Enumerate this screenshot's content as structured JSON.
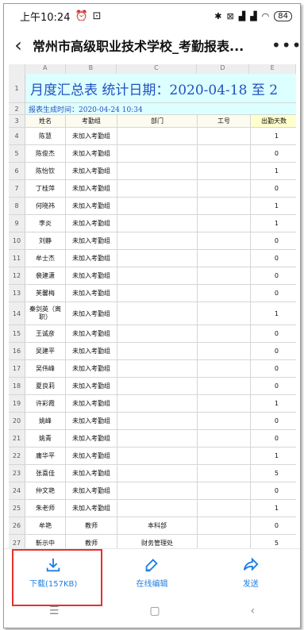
{
  "status": {
    "time": "上午10:24",
    "battery": "84"
  },
  "appbar": {
    "title": "常州市高级职业技术学校_考勤报表..."
  },
  "sheet": {
    "col_letters": [
      "A",
      "B",
      "C",
      "D",
      "E"
    ],
    "title_text": "月度汇总表  统计日期：2020-04-18 至 2",
    "generated": "报表生成时间：2020-04-24 10:34",
    "headers": [
      "姓名",
      "考勤组",
      "部门",
      "工号",
      "出勤天数"
    ],
    "rows": [
      {
        "n": "4",
        "name": "陈慧",
        "group": "未加入考勤组",
        "dept": "",
        "id": "",
        "days": "1"
      },
      {
        "n": "5",
        "name": "陈俊杰",
        "group": "未加入考勤组",
        "dept": "",
        "id": "",
        "days": "0"
      },
      {
        "n": "6",
        "name": "陈怡钦",
        "group": "未加入考勤组",
        "dept": "",
        "id": "",
        "days": "1"
      },
      {
        "n": "7",
        "name": "丁桂萍",
        "group": "未加入考勤组",
        "dept": "",
        "id": "",
        "days": "0"
      },
      {
        "n": "8",
        "name": "何晓祎",
        "group": "未加入考勤组",
        "dept": "",
        "id": "",
        "days": "1"
      },
      {
        "n": "9",
        "name": "李炎",
        "group": "未加入考勤组",
        "dept": "",
        "id": "",
        "days": "1"
      },
      {
        "n": "10",
        "name": "刘静",
        "group": "未加入考勤组",
        "dept": "",
        "id": "",
        "days": "0"
      },
      {
        "n": "11",
        "name": "牟士杰",
        "group": "未加入考勤组",
        "dept": "",
        "id": "",
        "days": "0"
      },
      {
        "n": "12",
        "name": "裴建潇",
        "group": "未加入考勤组",
        "dept": "",
        "id": "",
        "days": "0"
      },
      {
        "n": "13",
        "name": "芙馨梅",
        "group": "未加入考勤组",
        "dept": "",
        "id": "",
        "days": "0"
      },
      {
        "n": "14",
        "name": "秦剑英（离职）",
        "group": "未加入考勤组",
        "dept": "",
        "id": "",
        "days": "1"
      },
      {
        "n": "15",
        "name": "王诚彦",
        "group": "未加入考勤组",
        "dept": "",
        "id": "",
        "days": "0"
      },
      {
        "n": "16",
        "name": "吴建平",
        "group": "未加入考勤组",
        "dept": "",
        "id": "",
        "days": "0"
      },
      {
        "n": "17",
        "name": "吴伟峰",
        "group": "未加入考勤组",
        "dept": "",
        "id": "",
        "days": "0"
      },
      {
        "n": "18",
        "name": "夏良莉",
        "group": "未加入考勤组",
        "dept": "",
        "id": "",
        "days": "0"
      },
      {
        "n": "19",
        "name": "许彩霞",
        "group": "未加入考勤组",
        "dept": "",
        "id": "",
        "days": "1"
      },
      {
        "n": "20",
        "name": "姚峰",
        "group": "未加入考勤组",
        "dept": "",
        "id": "",
        "days": "0"
      },
      {
        "n": "21",
        "name": "姚青",
        "group": "未加入考勤组",
        "dept": "",
        "id": "",
        "days": "0"
      },
      {
        "n": "22",
        "name": "庸华平",
        "group": "未加入考勤组",
        "dept": "",
        "id": "",
        "days": "1"
      },
      {
        "n": "23",
        "name": "张喜佳",
        "group": "未加入考勤组",
        "dept": "",
        "id": "",
        "days": "5"
      },
      {
        "n": "24",
        "name": "仲文艳",
        "group": "未加入考勤组",
        "dept": "",
        "id": "",
        "days": "0"
      },
      {
        "n": "25",
        "name": "朱老师",
        "group": "未加入考勤组",
        "dept": "",
        "id": "",
        "days": "1"
      },
      {
        "n": "26",
        "name": "牟艳",
        "group": "教师",
        "dept": "本科部",
        "id": "",
        "days": "0"
      },
      {
        "n": "27",
        "name": "靳示中",
        "group": "教师",
        "dept": "财务管理处",
        "id": "",
        "days": "5"
      }
    ]
  },
  "toolbar": {
    "download_label": "下载(157KB)",
    "edit_label": "在线编辑",
    "send_label": "发送"
  }
}
